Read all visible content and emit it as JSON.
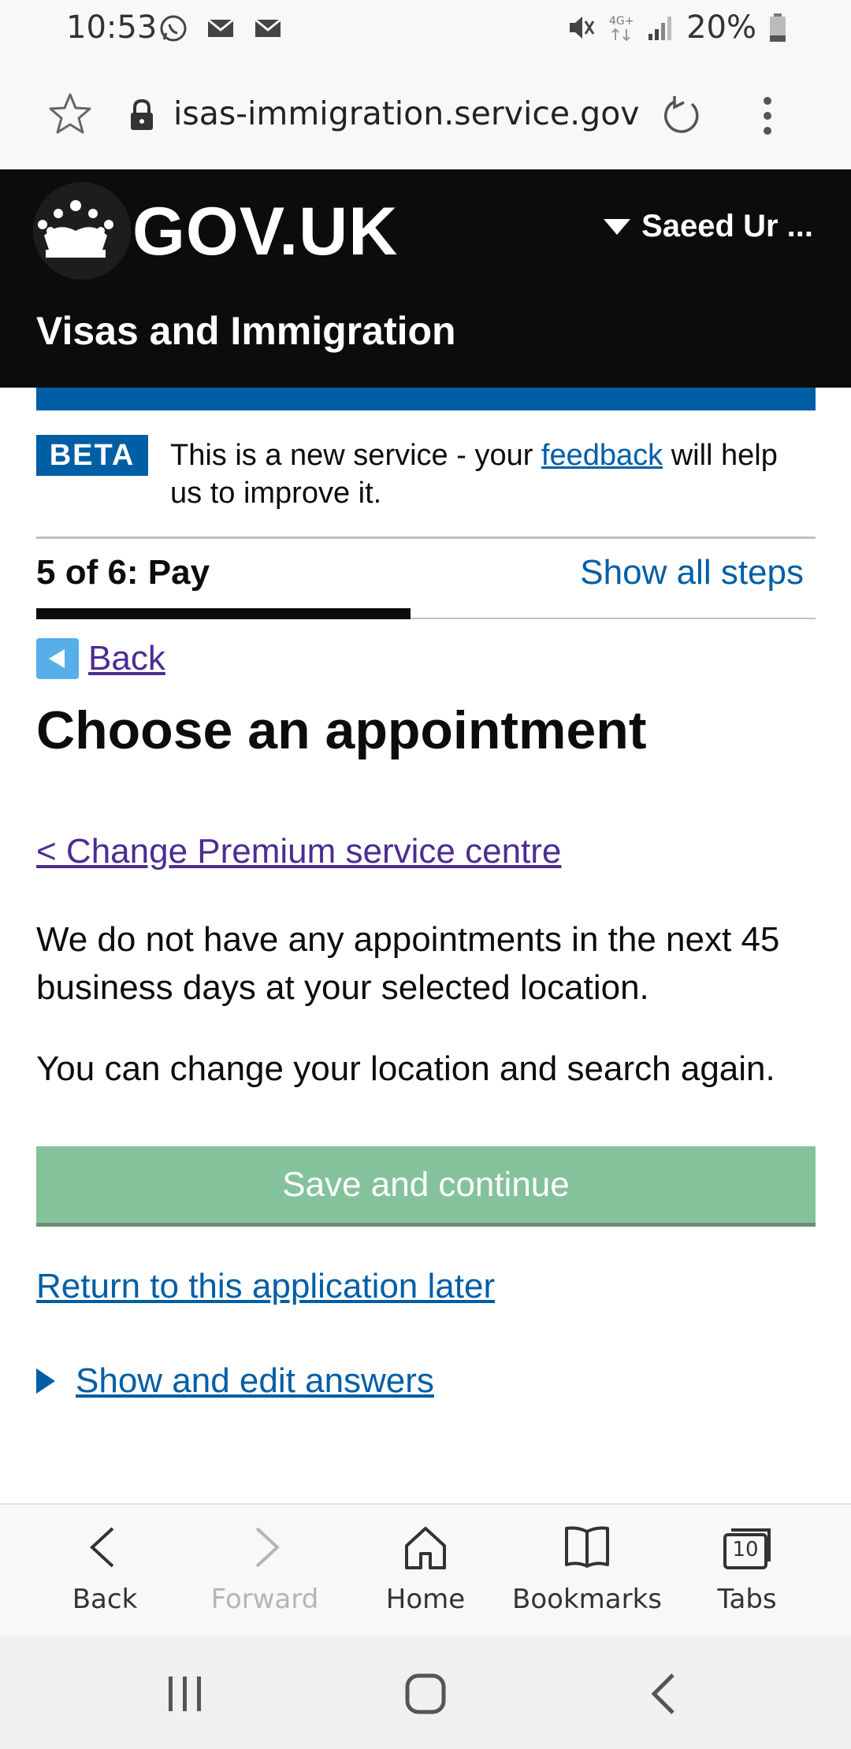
{
  "status_bar": {
    "time": "10:53",
    "battery_percent": "20%"
  },
  "browser": {
    "url": "isas-immigration.service.gov.uk"
  },
  "header": {
    "logo": "GOV.UK",
    "user": "Saeed Ur ...",
    "service_name": "Visas and Immigration"
  },
  "beta": {
    "tag": "BETA",
    "text_before": "This is a new service - your ",
    "link": "feedback",
    "text_after": " will help us to improve it."
  },
  "step": {
    "label": "5 of 6: Pay",
    "show_all": "Show all steps",
    "current": 5,
    "total": 6
  },
  "main": {
    "back": "Back",
    "title": "Choose an appointment",
    "change_link": "< Change Premium service centre",
    "para1": "We do not have any appointments in the next 45 business days at your selected location.",
    "para2": "You can change your location and search again.",
    "save_button": "Save and continue",
    "return_link": "Return to this application later",
    "details_summary": "Show and edit answers"
  },
  "toolbar": {
    "back": "Back",
    "forward": "Forward",
    "home": "Home",
    "bookmarks": "Bookmarks",
    "tabs": "Tabs",
    "tab_count": "10"
  },
  "colors": {
    "link_blue": "#005ea5",
    "visited_purple": "#4c2c92",
    "header_black": "#0b0c0c",
    "button_green": "#84c29b"
  }
}
